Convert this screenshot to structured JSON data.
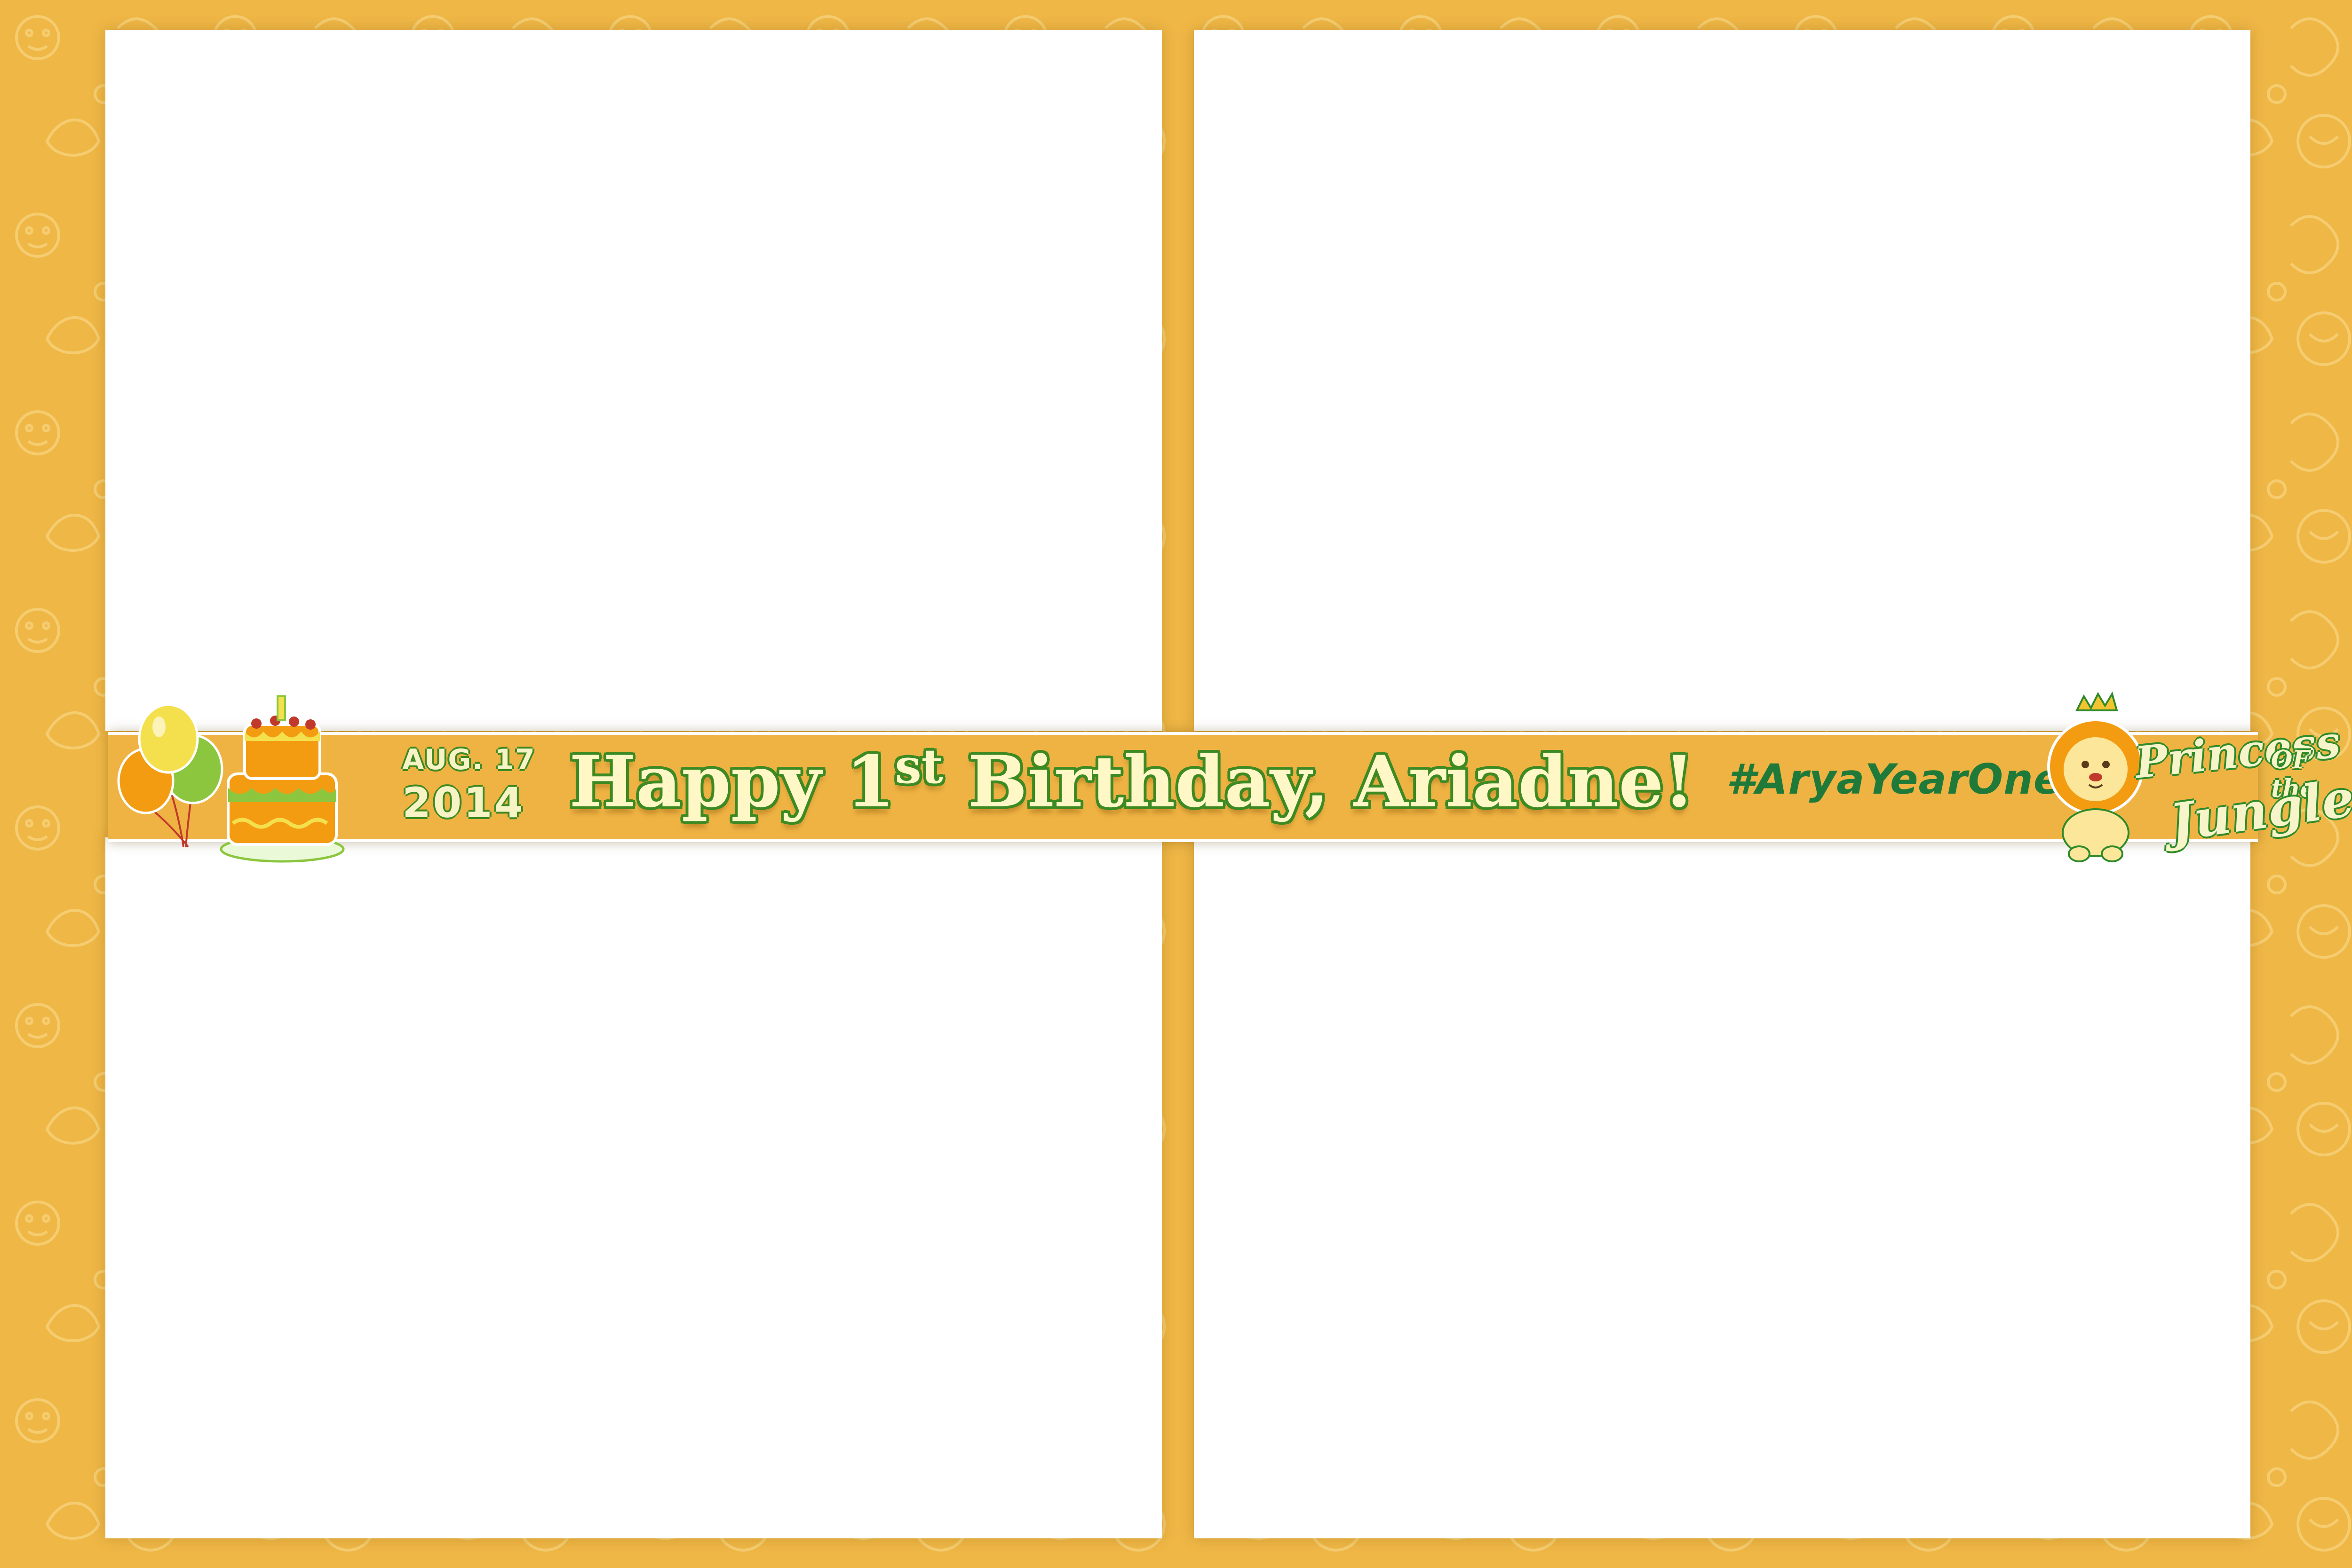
{
  "banner": {
    "date_line1": "AUG. 17",
    "date_line2": "2014",
    "headline_before": "Happy ",
    "headline_ordinal": "1",
    "headline_suffix": "st",
    "headline_after": " Birthday, Ariadne!",
    "hashtag": "#AryaYearOne"
  },
  "logo": {
    "line1": "Princess",
    "line2": "OF the",
    "line3": "Jungle"
  },
  "photo_slots": 4,
  "colors": {
    "frame": "#efb746",
    "banner_text": "#fff8c6",
    "text_outline": "#3d8a23",
    "hashtag": "#1f7a3a",
    "photo_area": "#ffffff"
  },
  "icons": [
    "balloons-icon",
    "birthday-cake-icon",
    "lion-mascot-icon",
    "crown-icon"
  ]
}
